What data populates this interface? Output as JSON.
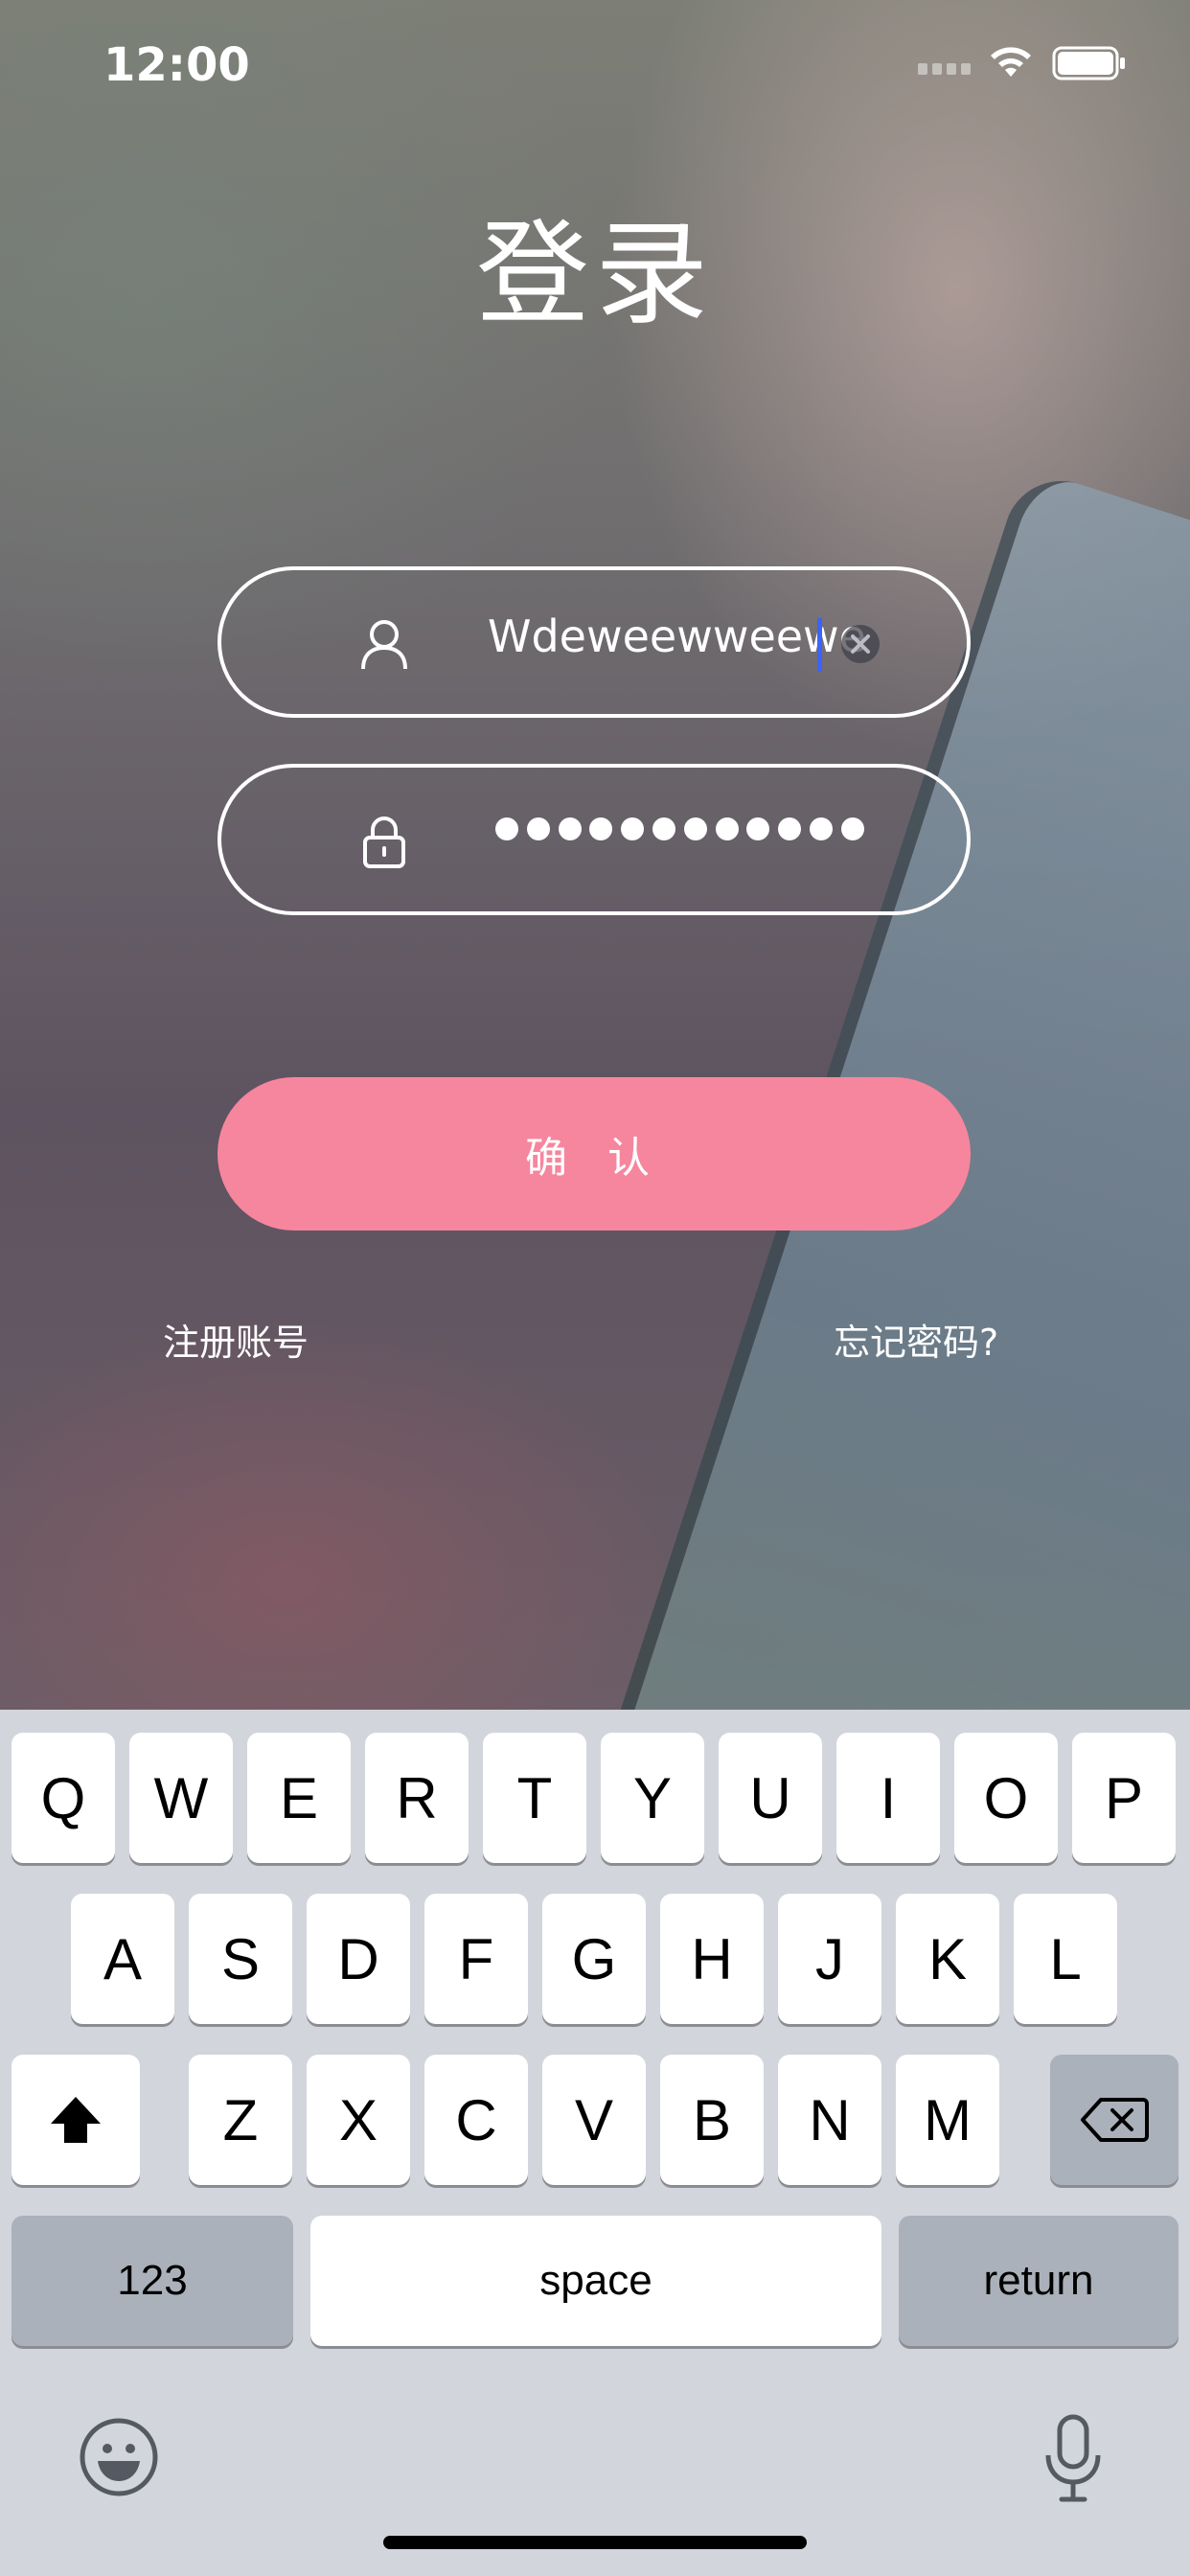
{
  "status_bar": {
    "time": "12:00"
  },
  "title": "登录",
  "username": {
    "value": "Wdeweewweewe",
    "icon": "user-icon"
  },
  "password": {
    "masked": "••••••••••••",
    "length": 12,
    "icon": "lock-icon"
  },
  "confirm_label": "确 认",
  "register_label": "注册账号",
  "forgot_label": "忘记密码?",
  "keyboard": {
    "row1": [
      "Q",
      "W",
      "E",
      "R",
      "T",
      "Y",
      "U",
      "I",
      "O",
      "P"
    ],
    "row2": [
      "A",
      "S",
      "D",
      "F",
      "G",
      "H",
      "J",
      "K",
      "L"
    ],
    "row3": [
      "Z",
      "X",
      "C",
      "V",
      "B",
      "N",
      "M"
    ],
    "numbers_label": "123",
    "space_label": "space",
    "return_label": "return"
  },
  "colors": {
    "accent": "#f6869d",
    "caret": "#3a63ff",
    "keyboard_bg": "#d2d5db"
  }
}
